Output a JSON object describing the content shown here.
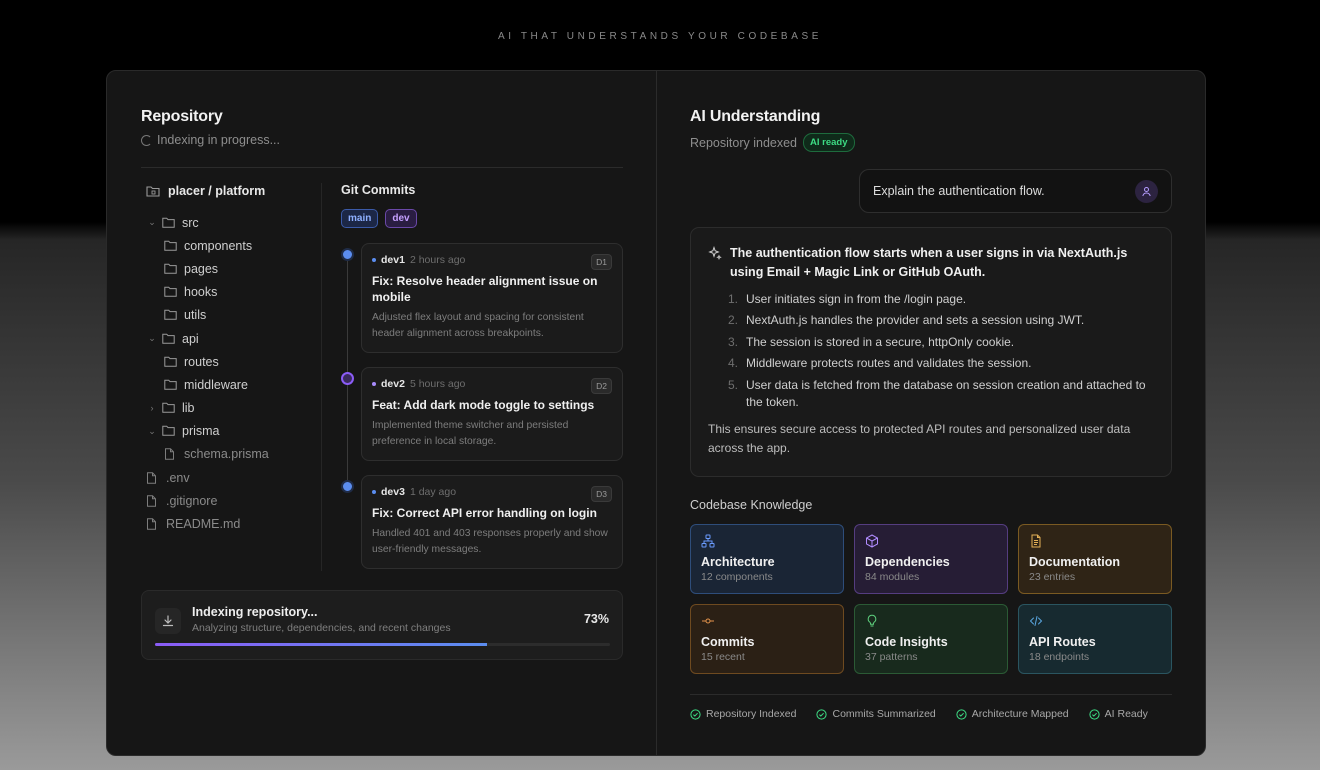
{
  "tagline": "AI THAT UNDERSTANDS YOUR CODEBASE",
  "repository": {
    "title": "Repository",
    "status": "Indexing in progress...",
    "root": "placer / platform",
    "tree": [
      {
        "name": "src",
        "type": "folder",
        "depth": 0,
        "chevron": "open"
      },
      {
        "name": "components",
        "type": "folder",
        "depth": 1
      },
      {
        "name": "pages",
        "type": "folder",
        "depth": 1
      },
      {
        "name": "hooks",
        "type": "folder",
        "depth": 1
      },
      {
        "name": "utils",
        "type": "folder",
        "depth": 1
      },
      {
        "name": "api",
        "type": "folder",
        "depth": 0,
        "chevron": "open"
      },
      {
        "name": "routes",
        "type": "folder",
        "depth": 1
      },
      {
        "name": "middleware",
        "type": "folder",
        "depth": 1
      },
      {
        "name": "lib",
        "type": "folder",
        "depth": 0,
        "chevron": "closed"
      },
      {
        "name": "prisma",
        "type": "folder",
        "depth": 0,
        "chevron": "open"
      },
      {
        "name": "schema.prisma",
        "type": "file",
        "depth": 1
      },
      {
        "name": ".env",
        "type": "file",
        "depth": -1
      },
      {
        "name": ".gitignore",
        "type": "file",
        "depth": -1
      },
      {
        "name": "README.md",
        "type": "file",
        "depth": -1
      }
    ],
    "commits_title": "Git Commits",
    "branches": [
      "main",
      "dev"
    ],
    "commits": [
      {
        "author": "dev1",
        "time": "2 hours ago",
        "badge": "D1",
        "message": "Fix: Resolve header alignment issue on mobile",
        "description": "Adjusted flex layout and spacing for consistent header alignment across breakpoints.",
        "color": "#5b8def"
      },
      {
        "author": "dev2",
        "time": "5 hours ago",
        "badge": "D2",
        "message": "Feat: Add dark mode toggle to settings",
        "description": "Implemented theme switcher and persisted preference in local storage.",
        "color": "#a78bfa"
      },
      {
        "author": "dev3",
        "time": "1 day ago",
        "badge": "D3",
        "message": "Fix: Correct API error handling on login",
        "description": "Handled 401 and 403 responses properly and show user-friendly messages.",
        "color": "#5b8def"
      }
    ],
    "progress": {
      "title": "Indexing repository...",
      "subtitle": "Analyzing structure, dependencies, and recent changes",
      "percent_label": "73%",
      "percent": 73
    }
  },
  "ai": {
    "title": "AI Understanding",
    "status": "Repository indexed",
    "badge": "AI ready",
    "query": "Explain the authentication flow.",
    "answer_lead": "The authentication flow starts when a user signs in via NextAuth.js using Email + Magic Link or GitHub OAuth.",
    "steps": [
      "User initiates sign in from the /login page.",
      "NextAuth.js handles the provider and sets a session using JWT.",
      "The session is stored in a secure, httpOnly cookie.",
      "Middleware protects routes and validates the session.",
      "User data is fetched from the database on session creation and attached to the token."
    ],
    "answer_closing": "This ensures secure access to protected API routes and personalized user data across the app.",
    "knowledge_title": "Codebase Knowledge",
    "knowledge": [
      {
        "name": "Architecture",
        "count": "12 components",
        "icon": "architecture-icon",
        "tone": "t-blue",
        "color": "#6b9cff"
      },
      {
        "name": "Dependencies",
        "count": "84 modules",
        "icon": "package-icon",
        "tone": "t-purple",
        "color": "#b18cff"
      },
      {
        "name": "Documentation",
        "count": "23 entries",
        "icon": "document-icon",
        "tone": "t-amber",
        "color": "#e3b056"
      },
      {
        "name": "Commits",
        "count": "15 recent",
        "icon": "commit-icon",
        "tone": "t-orange",
        "color": "#e0914a"
      },
      {
        "name": "Code Insights",
        "count": "37 patterns",
        "icon": "lightbulb-icon",
        "tone": "t-green",
        "color": "#5fd27f"
      },
      {
        "name": "API Routes",
        "count": "18 endpoints",
        "icon": "code-icon",
        "tone": "t-teal",
        "color": "#5aa7e0"
      }
    ],
    "checks": [
      "Repository Indexed",
      "Commits Summarized",
      "Architecture Mapped",
      "AI Ready"
    ]
  }
}
